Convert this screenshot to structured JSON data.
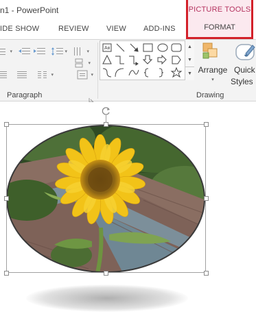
{
  "window": {
    "title": "n1 - PowerPoint"
  },
  "contextual_tab_group": {
    "label": "PICTURE TOOLS",
    "tab_label": "FORMAT",
    "accent_color": "#b5325f",
    "highlight_border_color": "#d32029"
  },
  "tabs": [
    {
      "label": "IDE SHOW"
    },
    {
      "label": "REVIEW"
    },
    {
      "label": "VIEW"
    },
    {
      "label": "ADD-INS"
    }
  ],
  "ribbon": {
    "groups": [
      {
        "label": "Paragraph"
      },
      {
        "label": "Drawing"
      }
    ],
    "drawing": {
      "arrange_label": "Arrange",
      "quick_styles_label_1": "Quick",
      "quick_styles_label_2": "Styles"
    },
    "shapes": [
      "text-box-icon",
      "line-icon",
      "arrow-line-icon",
      "rectangle-icon",
      "oval-icon",
      "rounded-rectangle-icon",
      "triangle-icon",
      "elbow-connector-icon",
      "elbow-arrow-connector-icon",
      "down-arrow-icon",
      "right-arrow-icon",
      "pentagon-icon",
      "curved-connector-icon",
      "arc-icon",
      "curve-icon",
      "left-brace-icon",
      "right-brace-icon",
      "star-icon"
    ]
  },
  "slide": {
    "picture": {
      "subject": "sunflower",
      "shape": "oval"
    }
  }
}
